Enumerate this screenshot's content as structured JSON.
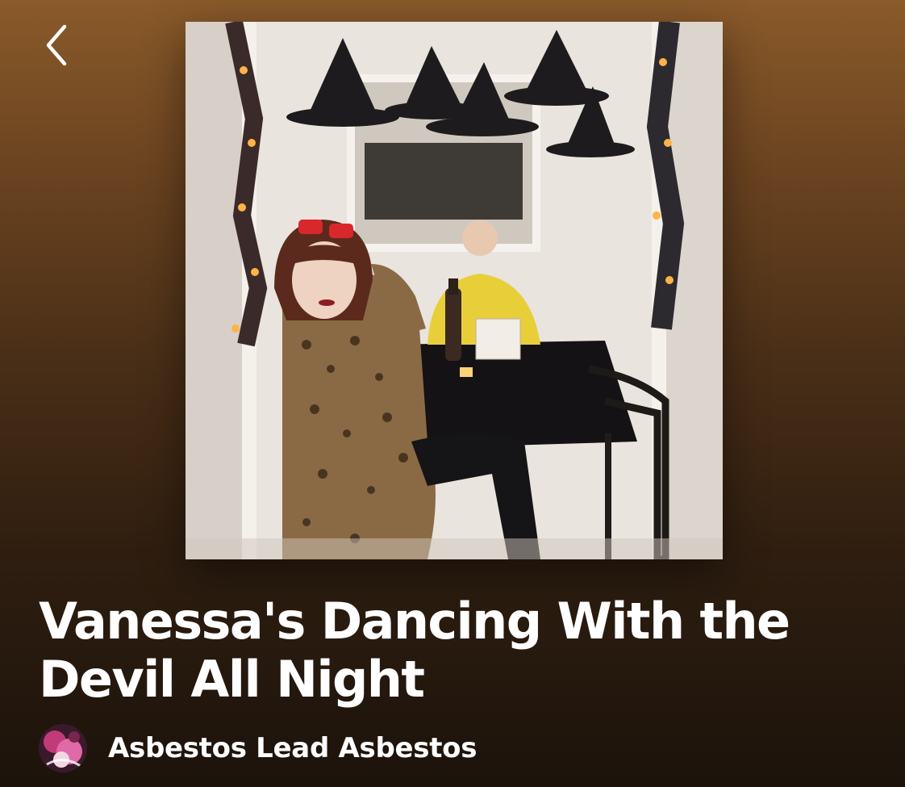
{
  "header": {
    "back_icon": "chevron-left-icon"
  },
  "album_art": {
    "alt": "Vanessa's Dancing With the Devil All Night"
  },
  "track": {
    "title": "Vanessa's Dancing With the Devil All Night"
  },
  "artist": {
    "name": "Asbestos Lead Asbestos",
    "avatar_icon": "artist-avatar"
  },
  "colors": {
    "background_top": "#8a5a2a",
    "background_bottom": "#1c130b",
    "text": "#ffffff"
  }
}
